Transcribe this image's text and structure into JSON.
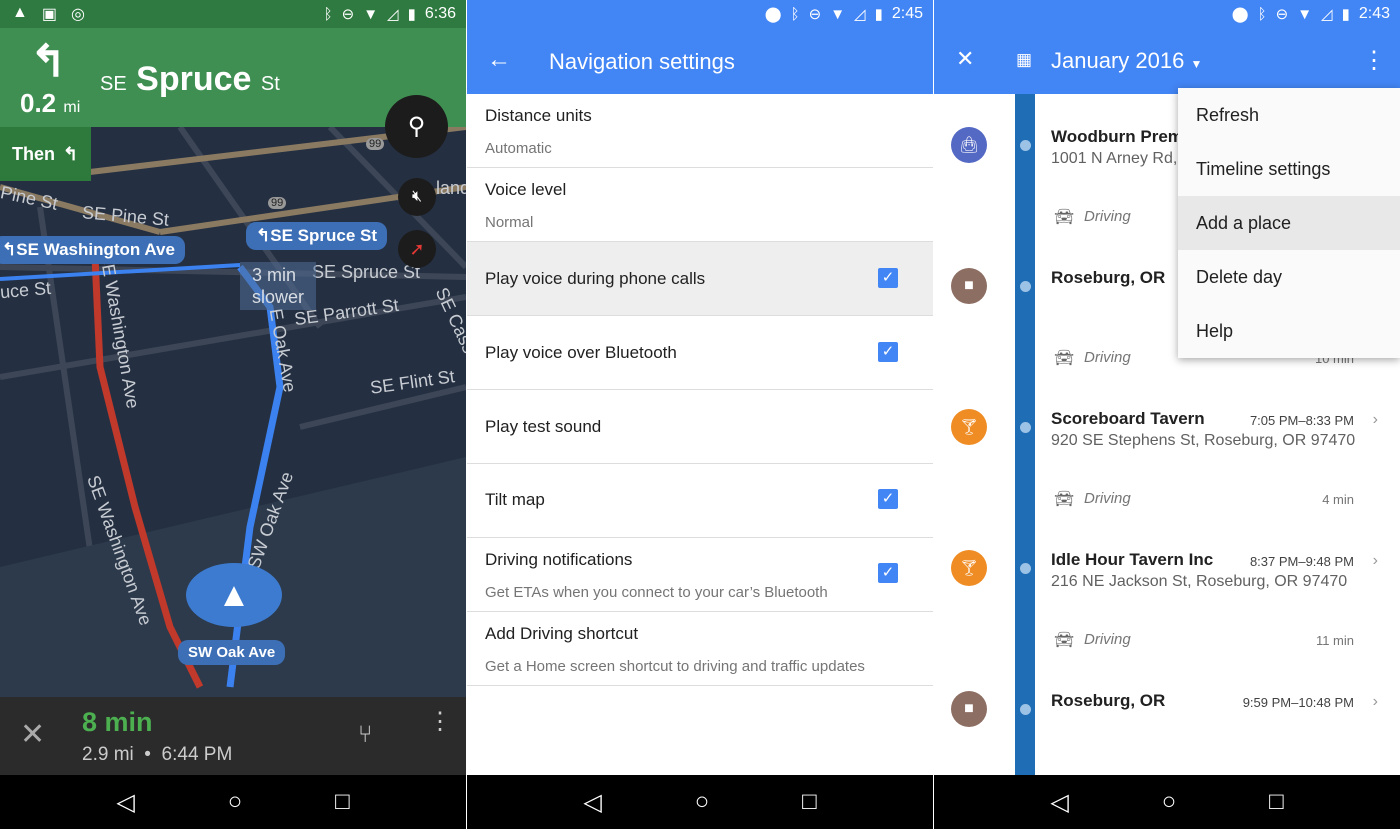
{
  "nav": {
    "time": "6:36",
    "distance": "0.2",
    "distance_unit": "mi",
    "street_prefix": "SE",
    "street_name": "Spruce",
    "street_suffix": "St",
    "then_label": "Then",
    "callouts": [
      "SE Washington Ave",
      "SE Spruce St",
      "SW Oak Ave"
    ],
    "alt_route": [
      "3 min",
      "slower"
    ],
    "map_labels": [
      "Pine St",
      "SE Pine St",
      "uce St",
      "SE Spruce St",
      "SE Parrott St",
      "SE Cass",
      "SE Flint St",
      "SE Washington Ave",
      "E Oak Ave",
      "SW Oak Ave",
      "SE Washington Ave",
      "99",
      "99",
      "land"
    ],
    "eta_minutes": "8 min",
    "eta_distance": "2.9 mi",
    "eta_time": "6:44 PM",
    "color_header": "#3f8f52"
  },
  "settings": {
    "time": "2:45",
    "title": "Navigation settings",
    "rows": [
      {
        "title": "Distance units",
        "subtitle": "Automatic"
      },
      {
        "title": "Voice level",
        "subtitle": "Normal"
      },
      {
        "title": "Play voice during phone calls",
        "checked": true
      },
      {
        "title": "Play voice over Bluetooth",
        "checked": true
      },
      {
        "title": "Play test sound"
      },
      {
        "title": "Tilt map",
        "checked": true
      },
      {
        "title": "Driving notifications",
        "subtitle": "Get ETAs when you connect to your car’s Bluetooth",
        "checked": true
      },
      {
        "title": "Add Driving shortcut",
        "subtitle": "Get a Home screen shortcut to driving and traffic updates"
      }
    ],
    "accent": "#4285f4"
  },
  "timeline": {
    "time": "2:43",
    "title": "January 2016",
    "places": [
      {
        "name": "Woodburn Prem",
        "address": "1001 N Arney Rd,",
        "time": "",
        "color": "#5469c4"
      },
      {
        "name": "Roseburg, OR",
        "address": "",
        "time": "",
        "color": "#8d6e63"
      },
      {
        "name": "Scoreboard Tavern",
        "address": "920 SE Stephens St, Roseburg, OR 97470",
        "time": "7:05 PM–8:33 PM",
        "color": "#ef8c23"
      },
      {
        "name": "Idle Hour Tavern Inc",
        "address": "216 NE Jackson St, Roseburg, OR 97470",
        "time": "8:37 PM–9:48 PM",
        "color": "#ef8c23"
      },
      {
        "name": "Roseburg, OR",
        "address": "",
        "time": "9:59 PM–10:48 PM",
        "color": "#8d6e63"
      }
    ],
    "drives": [
      {
        "label": "Driving",
        "duration": ""
      },
      {
        "label": "Driving",
        "duration": "10 min"
      },
      {
        "label": "Driving",
        "duration": "4 min"
      },
      {
        "label": "Driving",
        "duration": "11 min"
      }
    ],
    "menu": [
      "Refresh",
      "Timeline settings",
      "Add a place",
      "Delete day",
      "Help"
    ],
    "menu_highlighted": "Add a place"
  }
}
